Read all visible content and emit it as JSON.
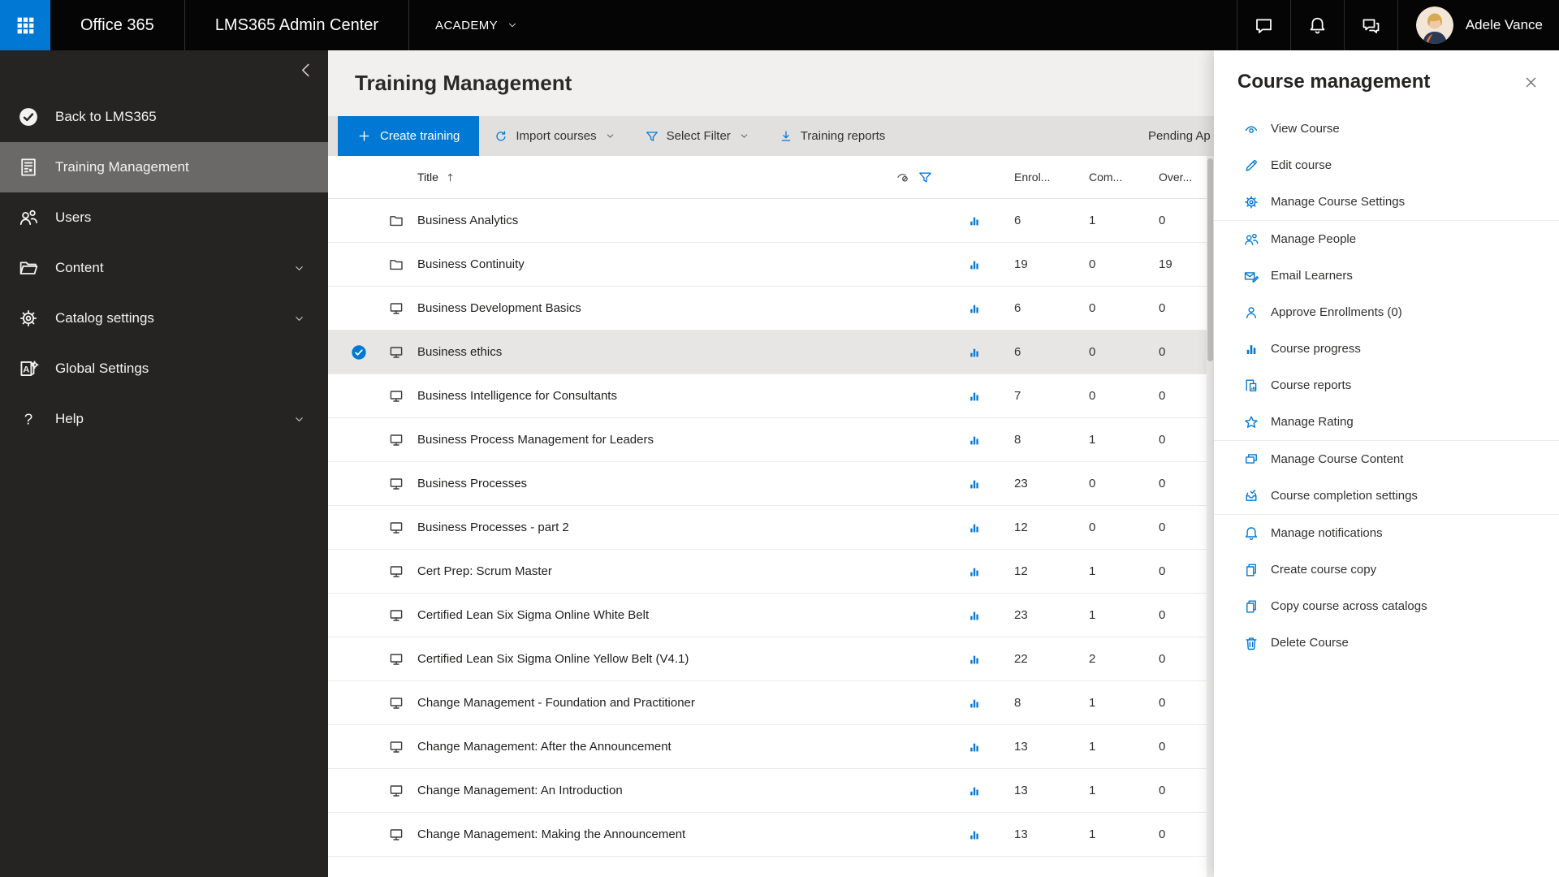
{
  "topbar": {
    "brand_primary": "Office 365",
    "brand_secondary": "LMS365 Admin Center",
    "catalog_name": "ACADEMY",
    "user_name": "Adele Vance",
    "icon_buttons": [
      {
        "icon": "chat"
      },
      {
        "icon": "bell"
      },
      {
        "icon": "feedback"
      }
    ]
  },
  "sidebar": {
    "items": [
      {
        "label": "Back to LMS365",
        "icon": "lms-logo",
        "selected": false,
        "expandable": false
      },
      {
        "label": "Training Management",
        "icon": "training-doc",
        "selected": true,
        "expandable": false
      },
      {
        "label": "Users",
        "icon": "users",
        "selected": false,
        "expandable": false
      },
      {
        "label": "Content",
        "icon": "folder-open",
        "selected": false,
        "expandable": true
      },
      {
        "label": "Catalog settings",
        "icon": "gear",
        "selected": false,
        "expandable": true
      },
      {
        "label": "Global Settings",
        "icon": "global-settings",
        "selected": false,
        "expandable": false
      },
      {
        "label": "Help",
        "icon": "help",
        "selected": false,
        "expandable": true
      }
    ]
  },
  "main": {
    "title": "Training Management",
    "toolbar": {
      "create_label": "Create training",
      "import_label": "Import courses",
      "filter_label": "Select Filter",
      "reports_label": "Training reports",
      "pending_label": "Pending Ap"
    },
    "table": {
      "columns": {
        "title": "Title",
        "enrolled": "Enrol...",
        "completed": "Com...",
        "overdue": "Over..."
      },
      "rows": [
        {
          "type": "folder",
          "title": "Business Analytics",
          "enrolled": "6",
          "completed": "1",
          "overdue": "0",
          "selected": false
        },
        {
          "type": "folder",
          "title": "Business Continuity",
          "enrolled": "19",
          "completed": "0",
          "overdue": "19",
          "selected": false
        },
        {
          "type": "course",
          "title": "Business Development Basics",
          "enrolled": "6",
          "completed": "0",
          "overdue": "0",
          "selected": false
        },
        {
          "type": "course",
          "title": "Business ethics",
          "enrolled": "6",
          "completed": "0",
          "overdue": "0",
          "selected": true
        },
        {
          "type": "course",
          "title": "Business Intelligence for Consultants",
          "enrolled": "7",
          "completed": "0",
          "overdue": "0",
          "selected": false
        },
        {
          "type": "course",
          "title": "Business Process Management for Leaders",
          "enrolled": "8",
          "completed": "1",
          "overdue": "0",
          "selected": false
        },
        {
          "type": "course",
          "title": "Business Processes",
          "enrolled": "23",
          "completed": "0",
          "overdue": "0",
          "selected": false
        },
        {
          "type": "course",
          "title": "Business Processes - part 2",
          "enrolled": "12",
          "completed": "0",
          "overdue": "0",
          "selected": false
        },
        {
          "type": "course",
          "title": "Cert Prep: Scrum Master",
          "enrolled": "12",
          "completed": "1",
          "overdue": "0",
          "selected": false
        },
        {
          "type": "course",
          "title": "Certified Lean Six Sigma Online White Belt",
          "enrolled": "23",
          "completed": "1",
          "overdue": "0",
          "selected": false
        },
        {
          "type": "course",
          "title": "Certified Lean Six Sigma Online Yellow Belt (V4.1)",
          "enrolled": "22",
          "completed": "2",
          "overdue": "0",
          "selected": false
        },
        {
          "type": "course",
          "title": "Change Management - Foundation and Practitioner",
          "enrolled": "8",
          "completed": "1",
          "overdue": "0",
          "selected": false
        },
        {
          "type": "course",
          "title": "Change Management: After the Announcement",
          "enrolled": "13",
          "completed": "1",
          "overdue": "0",
          "selected": false
        },
        {
          "type": "course",
          "title": "Change Management: An Introduction",
          "enrolled": "13",
          "completed": "1",
          "overdue": "0",
          "selected": false
        },
        {
          "type": "course",
          "title": "Change Management: Making the Announcement",
          "enrolled": "13",
          "completed": "1",
          "overdue": "0",
          "selected": false
        }
      ]
    }
  },
  "panel": {
    "title": "Course management",
    "groups": [
      [
        {
          "label": "View Course",
          "icon": "eye"
        },
        {
          "label": "Edit course",
          "icon": "pencil"
        },
        {
          "label": "Manage Course Settings",
          "icon": "gear"
        }
      ],
      [
        {
          "label": "Manage People",
          "icon": "people"
        },
        {
          "label": "Email Learners",
          "icon": "mail-edit"
        },
        {
          "label": "Approve Enrollments (0)",
          "icon": "person"
        },
        {
          "label": "Course progress",
          "icon": "chart-bars"
        },
        {
          "label": "Course reports",
          "icon": "report-doc"
        },
        {
          "label": "Manage Rating",
          "icon": "star"
        }
      ],
      [
        {
          "label": "Manage Course Content",
          "icon": "stack-windows"
        },
        {
          "label": "Course completion settings",
          "icon": "inbox-check"
        }
      ],
      [
        {
          "label": "Manage notifications",
          "icon": "bell"
        },
        {
          "label": "Create course copy",
          "icon": "copy-pages"
        },
        {
          "label": "Copy course across catalogs",
          "icon": "copy-pages"
        },
        {
          "label": "Delete Course",
          "icon": "trash"
        }
      ]
    ]
  },
  "colors": {
    "accent": "#0078d4",
    "topbar_bg": "#050505",
    "sidebar_bg": "#252423",
    "sidebar_selected_bg": "#6b6967",
    "toolbar_bg": "#e2e0de",
    "header_strip_bg": "#f1f0ef",
    "selected_row_bg": "#e8e6e4"
  }
}
